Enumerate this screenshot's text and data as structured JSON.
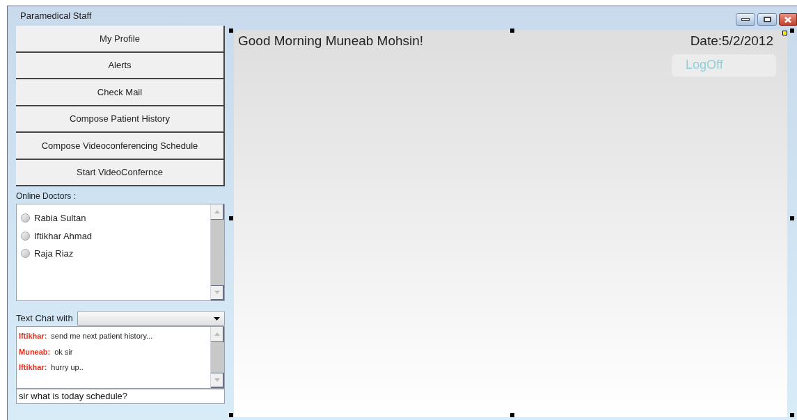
{
  "window": {
    "title": "Paramedical Staff"
  },
  "nav_buttons": [
    "My Profile",
    "Alerts",
    "Check Mail",
    "Compose Patient History",
    "Compose Videoconferencing Schedule",
    "Start VideoConfernce"
  ],
  "online_doctors": {
    "label": "Online Doctors :",
    "doctors": [
      {
        "name": "Rabia Sultan",
        "selected": false
      },
      {
        "name": "Iftikhar Ahmad",
        "selected": false
      },
      {
        "name": "Raja Riaz",
        "selected": false
      }
    ]
  },
  "chat": {
    "label": "Text Chat with",
    "messages": [
      {
        "sender": "Iftikhar:",
        "text": "send me next patient history..."
      },
      {
        "sender": "Muneab:",
        "text": "ok sir"
      },
      {
        "sender": "Iftikhar:",
        "text": "hurry up.."
      }
    ],
    "input": "sir what is today schedule?"
  },
  "main": {
    "greeting": "Good Morning Muneab Mohsin!",
    "date": "Date:5/2/2012",
    "logoff": "LogOff"
  }
}
